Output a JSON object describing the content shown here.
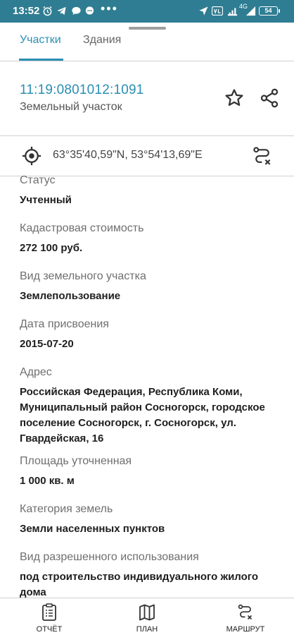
{
  "status_bar": {
    "time": "13:52",
    "icons": [
      "alarm-icon",
      "telegram-icon",
      "chat-icon",
      "bubble-icon",
      "more-dots-icon",
      "location-arrow-icon",
      "volte-icon",
      "signal-4g-icon",
      "battery-icon"
    ],
    "network": "4G",
    "battery": "54",
    "dots": "•••"
  },
  "tabs": [
    {
      "label": "Участки",
      "active": true
    },
    {
      "label": "Здания",
      "active": false
    }
  ],
  "parcel": {
    "cadastral_number": "11:19:0801012:1091",
    "type": "Земельный участок"
  },
  "location": {
    "coordinates": "63°35'40,59\"N, 53°54'13,69\"E"
  },
  "fields": [
    {
      "label": "Статус",
      "value": "Учтенный"
    },
    {
      "label": "Кадастровая стоимость",
      "value": "272 100 руб."
    },
    {
      "label": "Вид земельного участка",
      "value": "Землепользование"
    },
    {
      "label": "Дата присвоения",
      "value": "2015-07-20"
    },
    {
      "label": "Адрес",
      "value": "Российская Федерация, Республика Коми, Муниципальный район Сосногорск, городское поселение Сосногорск, г. Сосногорск, ул. Гвардейская, 16"
    },
    {
      "label": "Площадь уточненная",
      "value": "1 000 кв. м"
    },
    {
      "label": "Категория земель",
      "value": "Земли населенных пунктов"
    },
    {
      "label": "Вид разрешенного использования",
      "value": "под строительство индивидуального жилого дома"
    }
  ],
  "bottom_nav": [
    {
      "label": "ОТЧЁТ",
      "icon": "report-icon"
    },
    {
      "label": "ПЛАН",
      "icon": "map-icon"
    },
    {
      "label": "МАРШРУТ",
      "icon": "route-icon"
    }
  ],
  "colors": {
    "status_bar": "#2f7d92",
    "accent": "#2a8fb2"
  }
}
